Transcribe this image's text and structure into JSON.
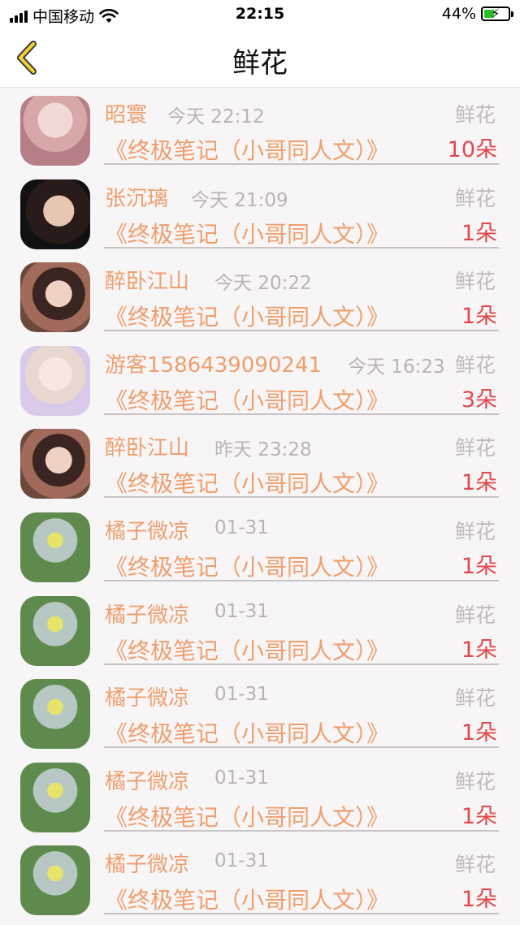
{
  "status_bar": {
    "carrier": "中国移动",
    "time": "22:15",
    "battery": "44%",
    "battery_level": 0.44
  },
  "nav": {
    "title": "鲜花"
  },
  "rows": [
    {
      "name": "昭寰",
      "time": "今天 22:12",
      "type": "鲜花",
      "book": "《终极笔记（小哥同人文）》",
      "count": "10朵"
    },
    {
      "name": "张沉璃",
      "time": "今天 21:09",
      "type": "鲜花",
      "book": "《终极笔记（小哥同人文）》",
      "count": "1朵"
    },
    {
      "name": "醉卧江山",
      "time": "今天 20:22",
      "type": "鲜花",
      "book": "《终极笔记（小哥同人文）》",
      "count": "1朵"
    },
    {
      "name": "游客1586439090241",
      "time": "今天 16:23",
      "type": "鲜花",
      "book": "《终极笔记（小哥同人文）》",
      "count": "3朵"
    },
    {
      "name": "醉卧江山",
      "time": "昨天 23:28",
      "type": "鲜花",
      "book": "《终极笔记（小哥同人文）》",
      "count": "1朵"
    },
    {
      "name": "橘子微凉",
      "time": "01-31",
      "type": "鲜花",
      "book": "《终极笔记（小哥同人文）》",
      "count": "1朵"
    },
    {
      "name": "橘子微凉",
      "time": "01-31",
      "type": "鲜花",
      "book": "《终极笔记（小哥同人文）》",
      "count": "1朵"
    },
    {
      "name": "橘子微凉",
      "time": "01-31",
      "type": "鲜花",
      "book": "《终极笔记（小哥同人文）》",
      "count": "1朵"
    },
    {
      "name": "橘子微凉",
      "time": "01-31",
      "type": "鲜花",
      "book": "《终极笔记（小哥同人文）》",
      "count": "1朵"
    },
    {
      "name": "橘子微凉",
      "time": "01-31",
      "type": "鲜花",
      "book": "《终极笔记（小哥同人文）》",
      "count": "1朵"
    }
  ]
}
